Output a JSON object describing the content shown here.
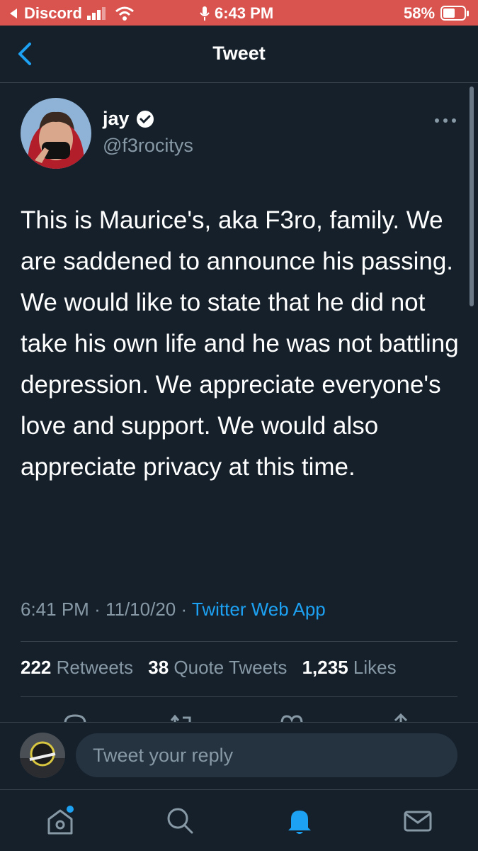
{
  "status_bar": {
    "back_app": "Discord",
    "time": "6:43 PM",
    "battery": "58%",
    "battery_level": 0.58,
    "bg_color": "#d9534f"
  },
  "header": {
    "title": "Tweet",
    "back_icon": "chevron-left-icon"
  },
  "tweet": {
    "author_name": "jay",
    "handle": "@f3rocitys",
    "verified": true,
    "text": "This is Maurice's, aka F3ro, family. We are saddened to announce his passing. We would like to state that he did not take his own life and he was not battling depression. We appreciate everyone's love and support. We would also appreciate privacy at this time.",
    "time": "6:41 PM",
    "date": "11/10/20",
    "separator": "·",
    "source_app": "Twitter Web App"
  },
  "stats": {
    "retweets_count": "222",
    "retweets_label": "Retweets",
    "quotes_count": "38",
    "quotes_label": "Quote Tweets",
    "likes_count": "1,235",
    "likes_label": "Likes"
  },
  "reply": {
    "placeholder": "Tweet your reply"
  },
  "tabs": [
    "home-icon",
    "search-icon",
    "notifications-icon",
    "messages-icon"
  ],
  "colors": {
    "background": "#15202b",
    "accent": "#1da1f2",
    "secondary_text": "#8899a6",
    "divider": "#38444d"
  }
}
